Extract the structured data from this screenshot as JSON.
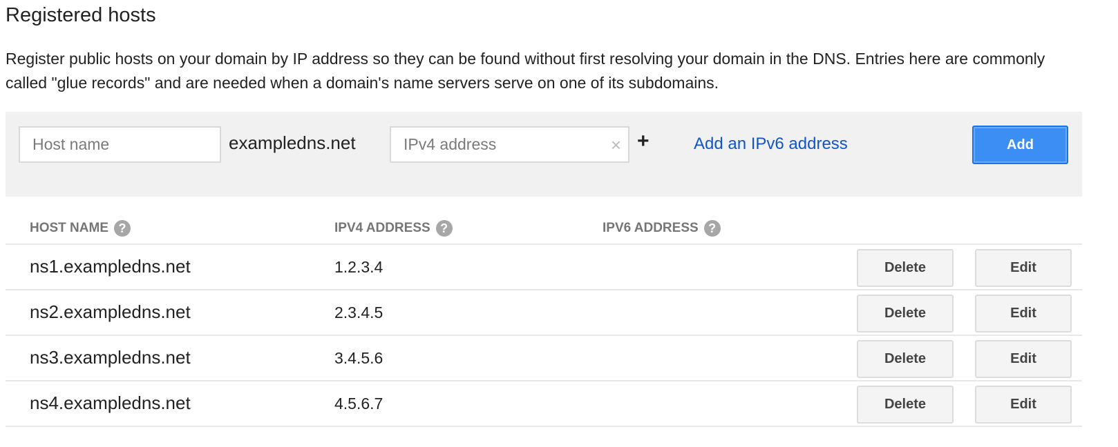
{
  "page": {
    "title": "Registered hosts",
    "description": "Register public hosts on your domain by IP address so they can be found without first resolving your domain in the DNS. Entries here are commonly called \"glue records\" and are needed when a domain's name servers serve on one of its subdomains."
  },
  "form": {
    "host_placeholder": "Host name",
    "host_value": "",
    "domain_suffix": "exampledns.net",
    "ipv4_placeholder": "IPv4 address",
    "ipv4_value": "",
    "clear_icon": "×",
    "plus_icon": "+",
    "add_ipv6_link": "Add an IPv6 address",
    "add_button": "Add",
    "accent_color": "#3b8ef3",
    "link_color": "#1155cc"
  },
  "table": {
    "columns": [
      {
        "label": "HOST NAME",
        "help_icon": "?"
      },
      {
        "label": "IPV4 ADDRESS",
        "help_icon": "?"
      },
      {
        "label": "IPV6 ADDRESS",
        "help_icon": "?"
      }
    ],
    "rows": [
      {
        "host": "ns1.exampledns.net",
        "ipv4": "1.2.3.4",
        "ipv6": "",
        "delete": "Delete",
        "edit": "Edit"
      },
      {
        "host": "ns2.exampledns.net",
        "ipv4": "2.3.4.5",
        "ipv6": "",
        "delete": "Delete",
        "edit": "Edit"
      },
      {
        "host": "ns3.exampledns.net",
        "ipv4": "3.4.5.6",
        "ipv6": "",
        "delete": "Delete",
        "edit": "Edit"
      },
      {
        "host": "ns4.exampledns.net",
        "ipv4": "4.5.6.7",
        "ipv6": "",
        "delete": "Delete",
        "edit": "Edit"
      }
    ]
  }
}
